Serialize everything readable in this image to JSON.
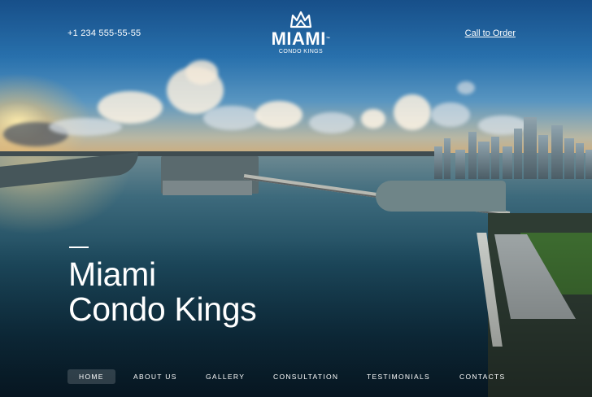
{
  "header": {
    "phone": "+1 234 555-55-55",
    "logo": {
      "icon": "crown-icon",
      "word": "MIAMI",
      "trademark": "™",
      "subtitle": "CONDO KINGS"
    },
    "cta_label": "Call to Order"
  },
  "hero": {
    "title_line1": "Miami",
    "title_line2": "Condo Kings"
  },
  "nav": {
    "items": [
      {
        "label": "HOME",
        "active": true
      },
      {
        "label": "ABOUT US",
        "active": false
      },
      {
        "label": "GALLERY",
        "active": false
      },
      {
        "label": "CONSULTATION",
        "active": false
      },
      {
        "label": "TESTIMONIALS",
        "active": false
      },
      {
        "label": "CONTACTS",
        "active": false
      }
    ]
  },
  "colors": {
    "text": "#ffffff",
    "sky_top": "#1a5a9c",
    "water_deep": "#0a2232",
    "sun_glow": "#ffd68c"
  }
}
